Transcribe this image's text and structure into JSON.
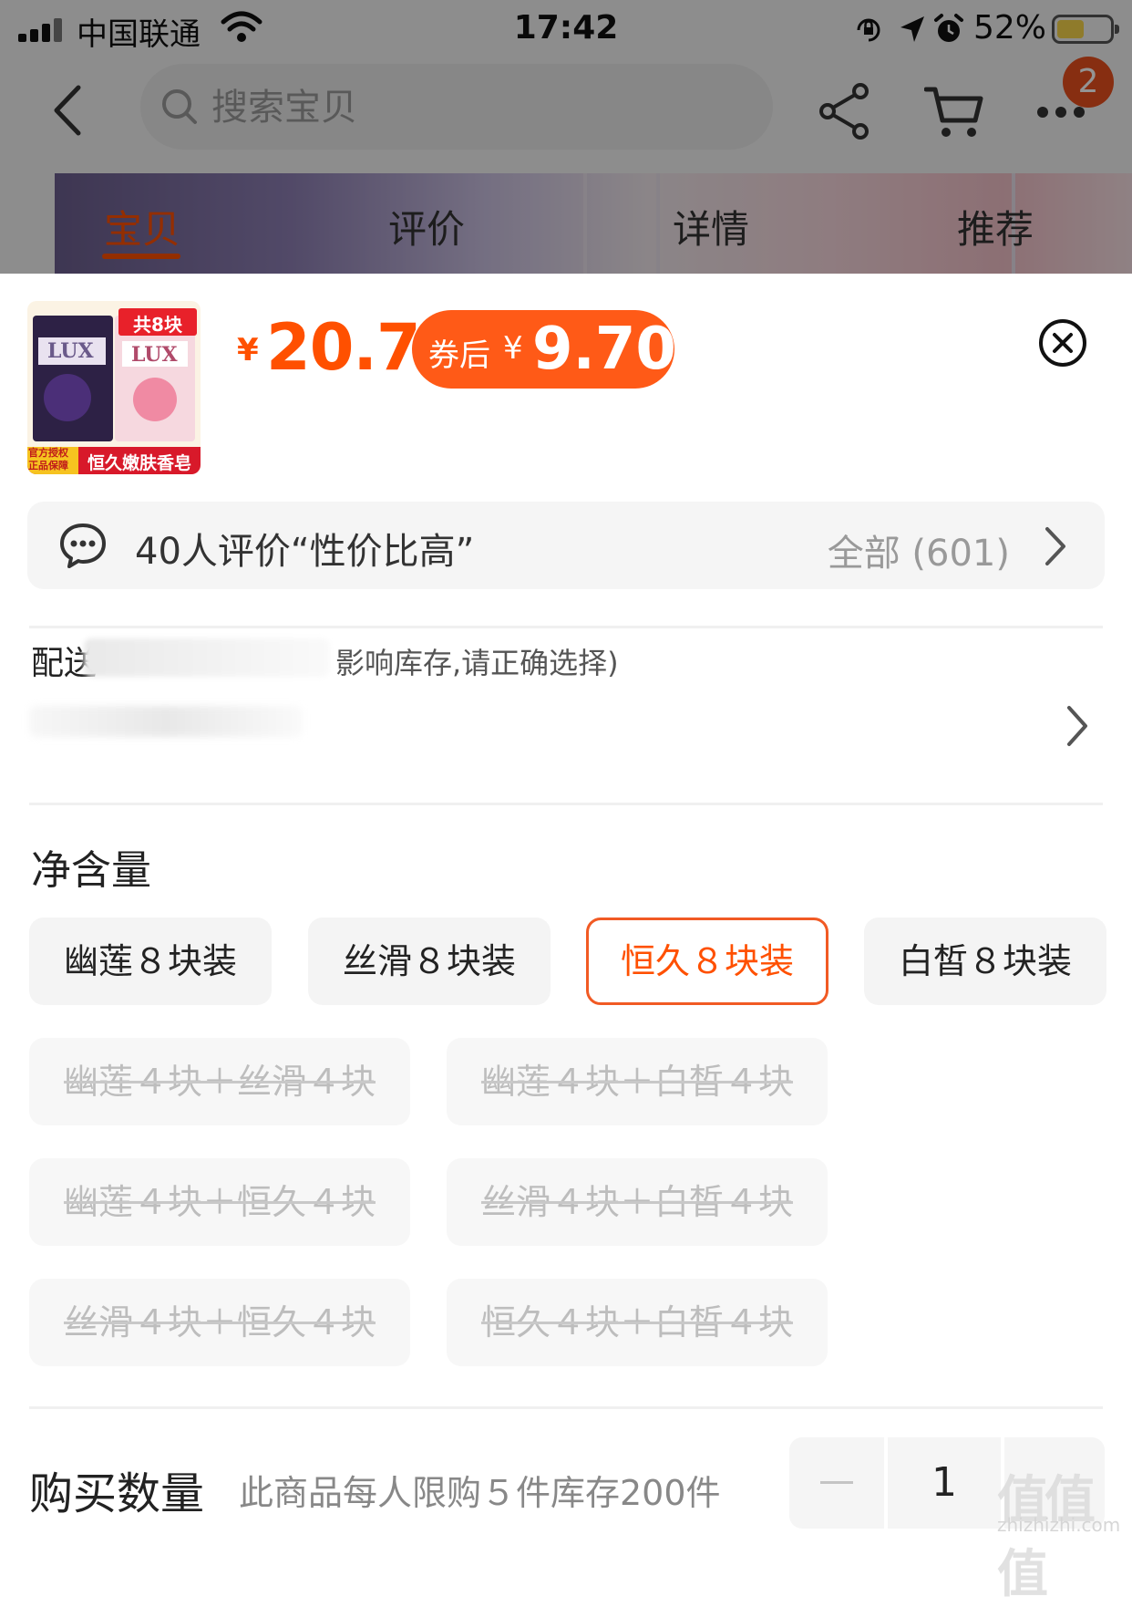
{
  "status_bar": {
    "carrier": "中国联通",
    "time": "17:42",
    "battery_percent": "52%",
    "battery_level": 0.52,
    "icons": [
      "signal-icon",
      "wifi-icon",
      "rotation-lock-icon",
      "location-icon",
      "alarm-icon",
      "battery-icon"
    ]
  },
  "header": {
    "search_placeholder": "搜索宝贝",
    "cart_badge": "2",
    "tabs": [
      {
        "label": "宝贝",
        "active": true
      },
      {
        "label": "评价",
        "active": false
      },
      {
        "label": "详情",
        "active": false
      },
      {
        "label": "推荐",
        "active": false
      }
    ]
  },
  "sku_panel": {
    "product_image_text": {
      "badge": "共8块",
      "brand": "LUX",
      "left_tag": "官方授权 正品保障",
      "right_tag": "恒久嫩肤香皂"
    },
    "currency_symbol": "¥",
    "price": "20.7",
    "coupon": {
      "label": "券后",
      "currency_symbol": "¥",
      "value": "9.70"
    },
    "review_summary": {
      "text": "40人评价“性价比高”",
      "all_label": "全部 (601)"
    },
    "delivery": {
      "label": "配送",
      "note": "影响库存,请正确选择)"
    },
    "net_content": {
      "title": "净含量",
      "options": [
        {
          "label": "幽莲８块装",
          "state": "normal"
        },
        {
          "label": "丝滑８块装",
          "state": "normal"
        },
        {
          "label": "恒久８块装",
          "state": "selected"
        },
        {
          "label": "白皙８块装",
          "state": "normal"
        },
        {
          "label": "幽莲４块＋丝滑４块",
          "state": "disabled"
        },
        {
          "label": "幽莲４块＋白皙４块",
          "state": "disabled"
        },
        {
          "label": "幽莲４块＋恒久４块",
          "state": "disabled"
        },
        {
          "label": "丝滑４块＋白皙４块",
          "state": "disabled"
        },
        {
          "label": "丝滑４块＋恒久４块",
          "state": "disabled"
        },
        {
          "label": "恒久４块＋白皙４块",
          "state": "disabled"
        }
      ]
    },
    "quantity": {
      "label": "购买数量",
      "note": "此商品每人限购５件库存200件",
      "value": "1"
    }
  },
  "watermark": {
    "main": "值值值",
    "sub": "zhizhizhi.com"
  },
  "colors": {
    "accent": "#ff5000",
    "coupon_bg": "#ff5a17",
    "selected_border": "#f15a24",
    "option_bg": "#f4f4f4",
    "disabled_text": "#bdbdbd",
    "badge_bg": "#e8501e"
  }
}
